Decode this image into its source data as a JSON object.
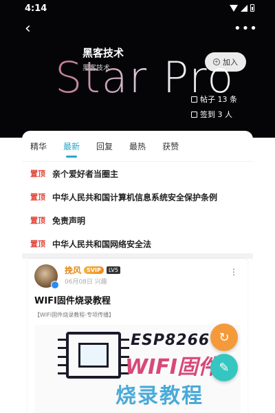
{
  "status_bar": {
    "time": "4:14"
  },
  "header": {
    "logo_text": "Star Pro",
    "group_name": "黑客技术",
    "group_sub": "黑客技术",
    "join_label": "加入",
    "posts_stat": "帖子 13 条",
    "checkin_stat": "签到 3 人",
    "colors": {
      "background": "#050507"
    }
  },
  "tabs": [
    {
      "label": "精华"
    },
    {
      "label": "最新",
      "active": true
    },
    {
      "label": "回复"
    },
    {
      "label": "最热"
    },
    {
      "label": "获赞"
    }
  ],
  "pinned": {
    "tag": "置顶",
    "items": [
      {
        "title": "亲个爱好者当圈主"
      },
      {
        "title": "中华人民共和国计算机信息系统安全保护条例"
      },
      {
        "title": "免责声明"
      },
      {
        "title": "中华人民共和国网络安全法"
      }
    ]
  },
  "post": {
    "author": "挽风",
    "vip_badge": "SVIP",
    "level_badge": "LV5",
    "meta": "06月08日 兴趣",
    "title": "WIFI固件烧录教程",
    "tag_line": "【WIFI固件烧录教程-专项传播】",
    "image": {
      "line1": "ESP8266",
      "line2": "WIFI固件",
      "line3": "烧录教程"
    }
  },
  "fab": {
    "refresh_icon": "refresh-icon",
    "edit_icon": "edit-icon"
  },
  "colors": {
    "accent": "#2aa6c9",
    "pin_red": "#e0463a",
    "fab_orange": "#f59a3a",
    "fab_teal": "#36c6c2"
  }
}
